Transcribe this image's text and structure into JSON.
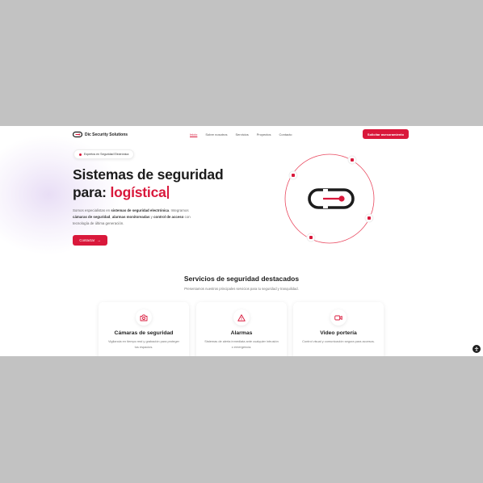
{
  "header": {
    "brand": "Dic Security Solutions",
    "nav": [
      "Inicio",
      "Sobre nosotros",
      "Servicios",
      "Proyectos",
      "Contacto"
    ],
    "cta": "Solicitar asesoramiento"
  },
  "hero": {
    "badge": "Expertos en Seguridad Electrónica",
    "title_line1": "Sistemas de seguridad",
    "title_prefix": "para: ",
    "title_highlight": "logística",
    "desc_1": "Somos especialistas en ",
    "desc_b1": "sistemas de seguridad electrónica",
    "desc_2": ". Integramos ",
    "desc_b2": "cámaras de seguridad",
    "desc_3": ", ",
    "desc_b3": "alarmas monitoreadas",
    "desc_4": " y ",
    "desc_b4": "control de acceso",
    "desc_5": " con tecnología de última generación.",
    "button": "Contactar"
  },
  "services": {
    "title": "Servicios de seguridad destacados",
    "subtitle": "Presentamos nuestros principales servicios para tu seguridad y tranquilidad.",
    "cards": [
      {
        "title": "Cámaras de seguridad",
        "text": "Vigilancia en tiempo real y grabación para proteger tus espacios.",
        "icon": "camera-icon"
      },
      {
        "title": "Alarmas",
        "text": "Sistemas de alerta inmediata ante cualquier intrusión o emergencia.",
        "icon": "alert-triangle-icon"
      },
      {
        "title": "Video portería",
        "text": "Control visual y comunicación segura para accesos.",
        "icon": "video-icon"
      }
    ]
  },
  "colors": {
    "accent": "#d9183b",
    "dark": "#1c1c1c",
    "backdrop": "#c2c2c2"
  }
}
